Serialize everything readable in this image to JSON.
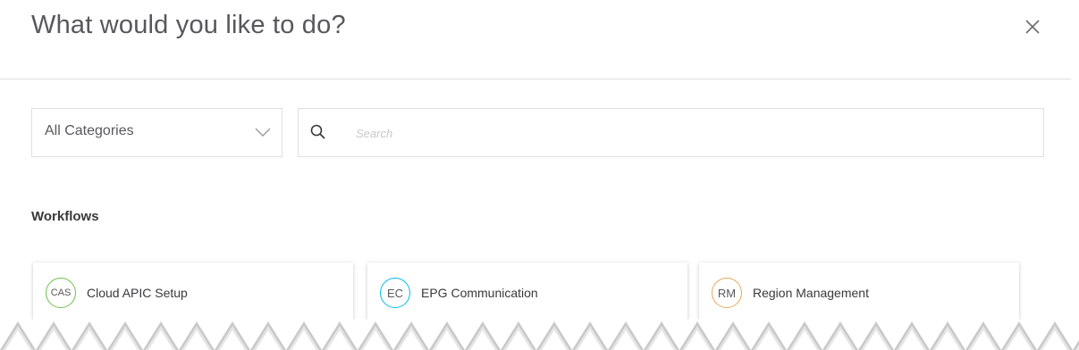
{
  "dialog": {
    "title": "What would you like to do?",
    "close_icon": "close-icon"
  },
  "filters": {
    "category_selected": "All Categories",
    "search_placeholder": "Search",
    "search_value": ""
  },
  "section": {
    "heading": "Workflows"
  },
  "workflows": [
    {
      "abbr": "CAS",
      "label": "Cloud APIC Setup",
      "color": "#6cc04a"
    },
    {
      "abbr": "EC",
      "label": "EPG Communication",
      "color": "#00bceb"
    },
    {
      "abbr": "RM",
      "label": "Region Management",
      "color": "#e2a85a"
    }
  ],
  "colors": {
    "border": "#dfdfdf",
    "text": "#39393b",
    "title": "#58585b"
  }
}
